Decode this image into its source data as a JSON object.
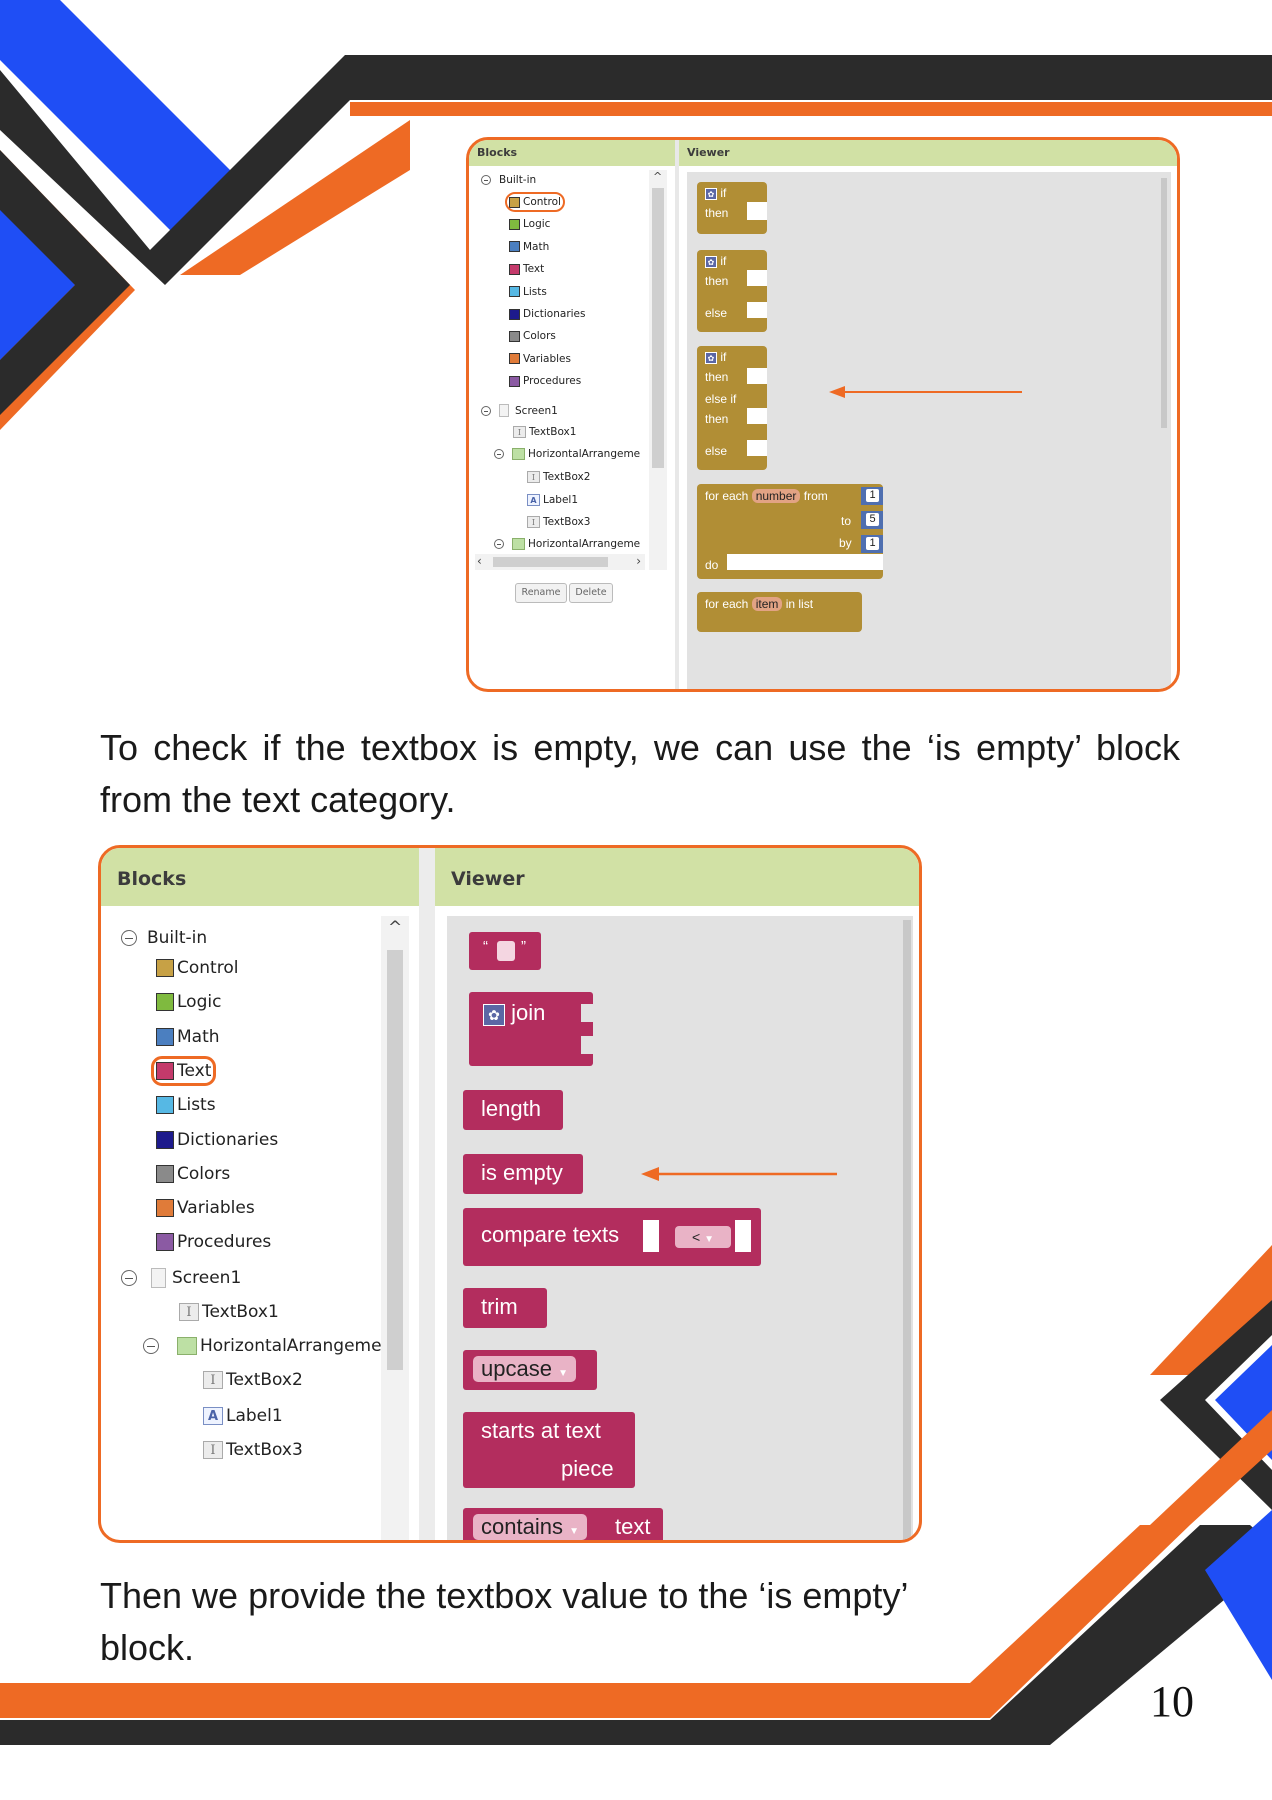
{
  "colors": {
    "orange": "#ee6a24",
    "dark": "#2b2b2b",
    "blue": "#1f4ef5",
    "control": "#b18e35",
    "text_block": "#b32d5e",
    "header_bg": "#d1e1a5"
  },
  "screenshot1": {
    "blocks_header": "Blocks",
    "viewer_header": "Viewer",
    "tree": {
      "builtin": "Built-in",
      "categories": [
        "Control",
        "Logic",
        "Math",
        "Text",
        "Lists",
        "Dictionaries",
        "Colors",
        "Variables",
        "Procedures"
      ],
      "category_colors": [
        "#c7a145",
        "#7fba3f",
        "#4b7fc0",
        "#c43a6b",
        "#56b8e4",
        "#1d1a8c",
        "#8a8a8a",
        "#e07b39",
        "#8b5aa3"
      ],
      "highlighted": "Control",
      "screen": "Screen1",
      "components": [
        "TextBox1",
        "HorizontalArrangeme",
        "TextBox2",
        "Label1",
        "TextBox3",
        "HorizontalArrangeme"
      ]
    },
    "buttons": {
      "rename": "Rename",
      "delete": "Delete"
    },
    "blocks": {
      "if": "if",
      "then": "then",
      "else": "else",
      "else_if": "else if",
      "for_each": "for each",
      "number": "number",
      "from": "from",
      "to": "to",
      "by": "by",
      "do": "do",
      "from_val": "1",
      "to_val": "5",
      "by_val": "1",
      "item": "item",
      "in_list": "in list"
    }
  },
  "paragraph1": "To check if the textbox is empty, we can use the ‘is empty’ block from the text category.",
  "screenshot2": {
    "blocks_header": "Blocks",
    "viewer_header": "Viewer",
    "tree": {
      "builtin": "Built-in",
      "categories": [
        "Control",
        "Logic",
        "Math",
        "Text",
        "Lists",
        "Dictionaries",
        "Colors",
        "Variables",
        "Procedures"
      ],
      "category_colors": [
        "#c7a145",
        "#7fba3f",
        "#4b7fc0",
        "#c43a6b",
        "#56b8e4",
        "#1d1a8c",
        "#8a8a8a",
        "#e07b39",
        "#8b5aa3"
      ],
      "highlighted": "Text",
      "screen": "Screen1",
      "components": [
        "TextBox1",
        "HorizontalArrangeme",
        "TextBox2",
        "Label1",
        "TextBox3"
      ]
    },
    "blocks": {
      "quote_open": "“",
      "quote_close": "”",
      "join": "join",
      "length": "length",
      "is_empty": "is empty",
      "compare_texts": "compare texts",
      "compare_op": "<",
      "trim": "trim",
      "upcase": "upcase",
      "starts_at_text": "starts at text",
      "piece": "piece",
      "contains": "contains",
      "text": "text"
    }
  },
  "paragraph2": "Then we provide the textbox value to the ‘is empty’ block.",
  "page_number": "10"
}
